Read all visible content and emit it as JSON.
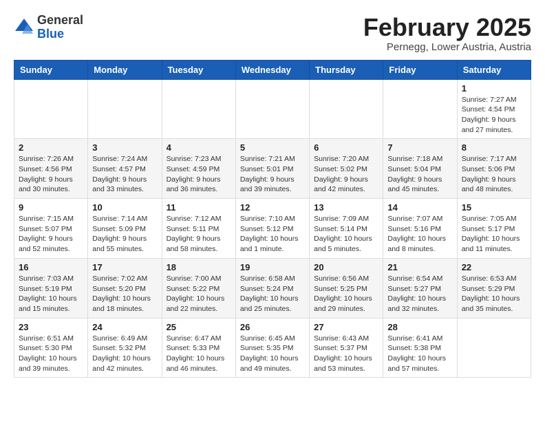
{
  "logo": {
    "general": "General",
    "blue": "Blue"
  },
  "title": {
    "month_year": "February 2025",
    "location": "Pernegg, Lower Austria, Austria"
  },
  "headers": [
    "Sunday",
    "Monday",
    "Tuesday",
    "Wednesday",
    "Thursday",
    "Friday",
    "Saturday"
  ],
  "weeks": [
    [
      {
        "day": "",
        "info": ""
      },
      {
        "day": "",
        "info": ""
      },
      {
        "day": "",
        "info": ""
      },
      {
        "day": "",
        "info": ""
      },
      {
        "day": "",
        "info": ""
      },
      {
        "day": "",
        "info": ""
      },
      {
        "day": "1",
        "info": "Sunrise: 7:27 AM\nSunset: 4:54 PM\nDaylight: 9 hours and 27 minutes."
      }
    ],
    [
      {
        "day": "2",
        "info": "Sunrise: 7:26 AM\nSunset: 4:56 PM\nDaylight: 9 hours and 30 minutes."
      },
      {
        "day": "3",
        "info": "Sunrise: 7:24 AM\nSunset: 4:57 PM\nDaylight: 9 hours and 33 minutes."
      },
      {
        "day": "4",
        "info": "Sunrise: 7:23 AM\nSunset: 4:59 PM\nDaylight: 9 hours and 36 minutes."
      },
      {
        "day": "5",
        "info": "Sunrise: 7:21 AM\nSunset: 5:01 PM\nDaylight: 9 hours and 39 minutes."
      },
      {
        "day": "6",
        "info": "Sunrise: 7:20 AM\nSunset: 5:02 PM\nDaylight: 9 hours and 42 minutes."
      },
      {
        "day": "7",
        "info": "Sunrise: 7:18 AM\nSunset: 5:04 PM\nDaylight: 9 hours and 45 minutes."
      },
      {
        "day": "8",
        "info": "Sunrise: 7:17 AM\nSunset: 5:06 PM\nDaylight: 9 hours and 48 minutes."
      }
    ],
    [
      {
        "day": "9",
        "info": "Sunrise: 7:15 AM\nSunset: 5:07 PM\nDaylight: 9 hours and 52 minutes."
      },
      {
        "day": "10",
        "info": "Sunrise: 7:14 AM\nSunset: 5:09 PM\nDaylight: 9 hours and 55 minutes."
      },
      {
        "day": "11",
        "info": "Sunrise: 7:12 AM\nSunset: 5:11 PM\nDaylight: 9 hours and 58 minutes."
      },
      {
        "day": "12",
        "info": "Sunrise: 7:10 AM\nSunset: 5:12 PM\nDaylight: 10 hours and 1 minute."
      },
      {
        "day": "13",
        "info": "Sunrise: 7:09 AM\nSunset: 5:14 PM\nDaylight: 10 hours and 5 minutes."
      },
      {
        "day": "14",
        "info": "Sunrise: 7:07 AM\nSunset: 5:16 PM\nDaylight: 10 hours and 8 minutes."
      },
      {
        "day": "15",
        "info": "Sunrise: 7:05 AM\nSunset: 5:17 PM\nDaylight: 10 hours and 11 minutes."
      }
    ],
    [
      {
        "day": "16",
        "info": "Sunrise: 7:03 AM\nSunset: 5:19 PM\nDaylight: 10 hours and 15 minutes."
      },
      {
        "day": "17",
        "info": "Sunrise: 7:02 AM\nSunset: 5:20 PM\nDaylight: 10 hours and 18 minutes."
      },
      {
        "day": "18",
        "info": "Sunrise: 7:00 AM\nSunset: 5:22 PM\nDaylight: 10 hours and 22 minutes."
      },
      {
        "day": "19",
        "info": "Sunrise: 6:58 AM\nSunset: 5:24 PM\nDaylight: 10 hours and 25 minutes."
      },
      {
        "day": "20",
        "info": "Sunrise: 6:56 AM\nSunset: 5:25 PM\nDaylight: 10 hours and 29 minutes."
      },
      {
        "day": "21",
        "info": "Sunrise: 6:54 AM\nSunset: 5:27 PM\nDaylight: 10 hours and 32 minutes."
      },
      {
        "day": "22",
        "info": "Sunrise: 6:53 AM\nSunset: 5:29 PM\nDaylight: 10 hours and 35 minutes."
      }
    ],
    [
      {
        "day": "23",
        "info": "Sunrise: 6:51 AM\nSunset: 5:30 PM\nDaylight: 10 hours and 39 minutes."
      },
      {
        "day": "24",
        "info": "Sunrise: 6:49 AM\nSunset: 5:32 PM\nDaylight: 10 hours and 42 minutes."
      },
      {
        "day": "25",
        "info": "Sunrise: 6:47 AM\nSunset: 5:33 PM\nDaylight: 10 hours and 46 minutes."
      },
      {
        "day": "26",
        "info": "Sunrise: 6:45 AM\nSunset: 5:35 PM\nDaylight: 10 hours and 49 minutes."
      },
      {
        "day": "27",
        "info": "Sunrise: 6:43 AM\nSunset: 5:37 PM\nDaylight: 10 hours and 53 minutes."
      },
      {
        "day": "28",
        "info": "Sunrise: 6:41 AM\nSunset: 5:38 PM\nDaylight: 10 hours and 57 minutes."
      },
      {
        "day": "",
        "info": ""
      }
    ]
  ]
}
